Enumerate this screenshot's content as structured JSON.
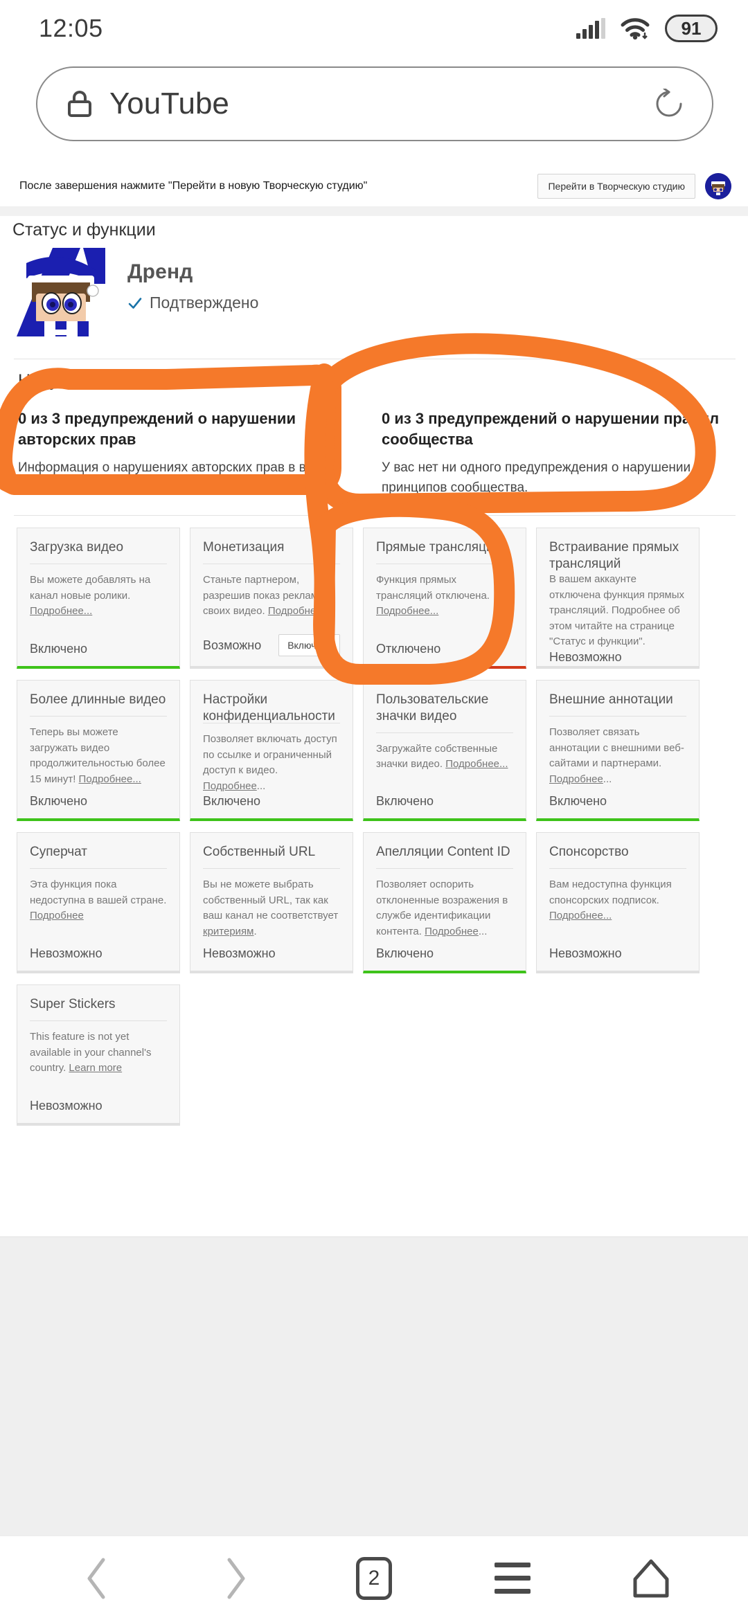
{
  "status_bar": {
    "time": "12:05",
    "battery": "91",
    "signal_icon": "signal-bars-icon",
    "wifi_icon": "wifi-icon",
    "battery_icon": "battery-icon"
  },
  "browser": {
    "lock_icon": "lock-icon",
    "url": "YouTube",
    "reload_icon": "reload-icon",
    "nav": {
      "back_icon": "chevron-left-icon",
      "forward_icon": "chevron-right-icon",
      "tab_count": "2",
      "menu_icon": "hamburger-menu-icon",
      "home_icon": "home-icon"
    }
  },
  "studio_banner": {
    "message": "После завершения нажмите \"Перейти в новую Творческую студию\"",
    "button_label": "Перейти в Творческую студию",
    "avatar_name": "channel-avatar"
  },
  "page": {
    "title": "Статус и функции"
  },
  "channel": {
    "name": "Дренд",
    "verified_label": "Подтверждено",
    "verified_icon": "check-icon",
    "avatar_name": "channel-avatar-large"
  },
  "strikes": {
    "heading": "Нарушения",
    "items": [
      {
        "title": "0 из 3 предупреждений о нарушении авторских прав",
        "desc": "Информация о нарушениях авторских прав в вашем аккаунте приведена ниже."
      },
      {
        "title": "0 из 3 предупреждений о нарушении правил сообщества",
        "desc": "У вас нет ни одного предупреждения о нарушении принципов сообщества."
      }
    ]
  },
  "features": [
    {
      "title": "Загрузка видео",
      "desc": "Вы можете добавлять на канал новые ролики. ",
      "link": "Подробнее...",
      "status": "Включено",
      "bar": "green",
      "action": null
    },
    {
      "title": "Монетизация",
      "desc": "Станьте партнером, разрешив показ рекламы в своих видео. ",
      "link": "Подробнее...",
      "status": "Возможно",
      "bar": "none",
      "action": "Включить"
    },
    {
      "title": "Прямые трансляции",
      "desc": "Функция прямых трансляций отключена. ",
      "link": "Подробнее...",
      "status": "Отключено",
      "bar": "red",
      "action": null
    },
    {
      "title": "Встраивание прямых трансляций",
      "desc": "В вашем аккаунте отключена функция прямых трансляций. Подробнее об этом читайте на странице \"Статус и функции\".",
      "link": "",
      "status": "Невозможно",
      "bar": "none",
      "action": null
    },
    {
      "title": "Более длинные видео",
      "desc": "Теперь вы можете загружать видео продолжительностью более 15 минут! ",
      "link": "Подробнее...",
      "status": "Включено",
      "bar": "green",
      "action": null
    },
    {
      "title": "Настройки конфиденциальности",
      "desc": "Позволяет включать доступ по ссылке и ограниченный доступ к видео. ",
      "link": "Подробнее",
      "link_suffix": "...",
      "status": "Включено",
      "bar": "green",
      "action": null
    },
    {
      "title": "Пользовательские значки видео",
      "desc": "Загружайте собственные значки видео. ",
      "link": "Подробнее...",
      "status": "Включено",
      "bar": "green",
      "action": null
    },
    {
      "title": "Внешние аннотации",
      "desc": "Позволяет связать аннотации с внешними веб-сайтами и партнерами. ",
      "link": "Подробнее",
      "link_suffix": "...",
      "status": "Включено",
      "bar": "green",
      "action": null
    },
    {
      "title": "Суперчат",
      "desc": "Эта функция пока недоступна в вашей стране. ",
      "link": "Подробнее",
      "status": "Невозможно",
      "bar": "none",
      "action": null
    },
    {
      "title": "Собственный URL",
      "desc": "Вы не можете выбрать собственный URL, так как ваш канал не соответствует ",
      "link": "критериям",
      "link_suffix": ".",
      "status": "Невозможно",
      "bar": "none",
      "action": null
    },
    {
      "title": "Апелляции Content ID",
      "desc": "Позволяет оспорить отклоненные возражения в службе идентификации контента. ",
      "link": "Подробнее",
      "link_suffix": "...",
      "status": "Включено",
      "bar": "green",
      "action": null
    },
    {
      "title": "Спонсорство",
      "desc": "Вам недоступна функция спонсорских подписок. ",
      "link": "Подробнее...",
      "status": "Невозможно",
      "bar": "none",
      "action": null
    },
    {
      "title": "Super Stickers",
      "desc": "This feature is not yet available in your channel's country. ",
      "link": "Learn more",
      "status": "Невозможно",
      "bar": "none",
      "action": null
    }
  ],
  "annotation": {
    "name": "orange-handdrawn-circles",
    "color": "#F5792A"
  }
}
